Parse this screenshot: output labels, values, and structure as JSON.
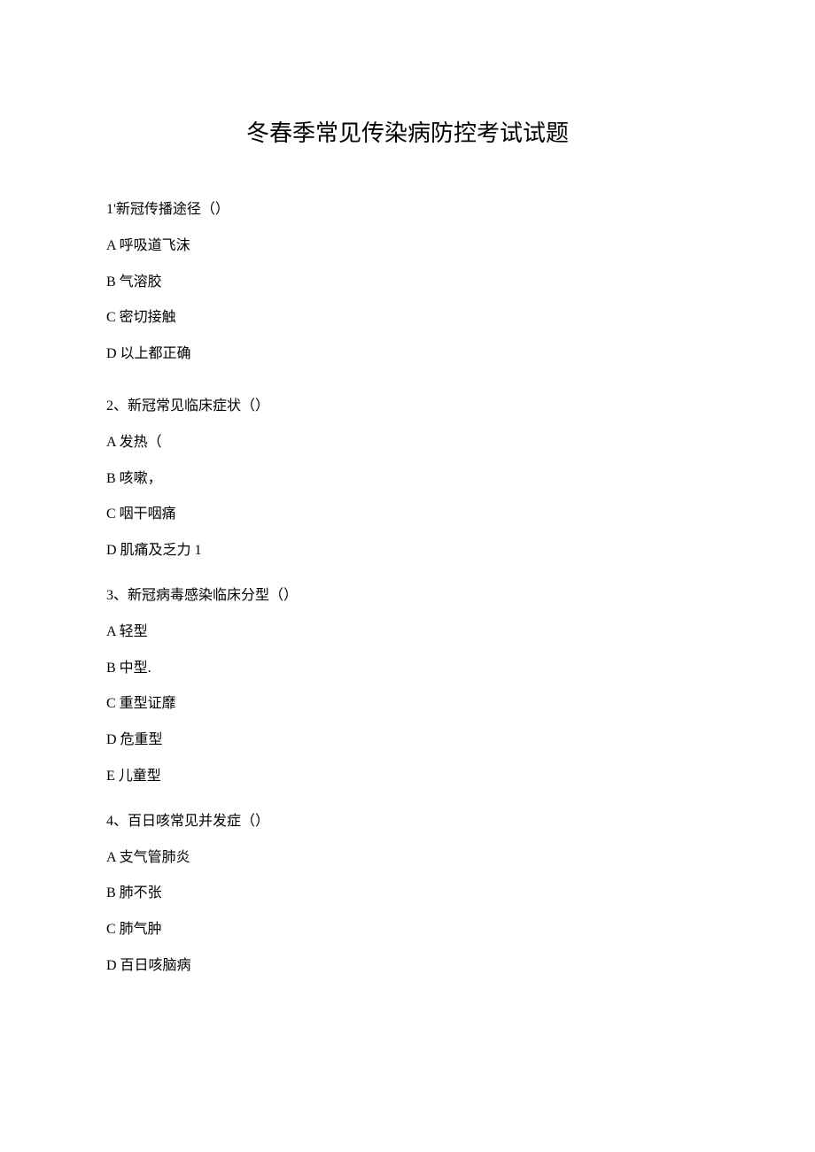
{
  "title": "冬春季常见传染病防控考试试题",
  "questions": [
    {
      "prompt": "1'新冠传播途径（）",
      "options": [
        "A 呼吸道飞沫",
        "B 气溶胶",
        "C 密切接触",
        "D 以上都正确"
      ]
    },
    {
      "prompt": "2、新冠常见临床症状（）",
      "options": [
        "A 发热（",
        "B 咳嗽，",
        "C 咽干咽痛",
        "D 肌痛及乏力 1"
      ]
    },
    {
      "prompt": "3、新冠病毒感染临床分型（）",
      "options": [
        "A 轻型",
        "B 中型.",
        "C 重型证靡",
        "D 危重型",
        "E 儿童型"
      ]
    },
    {
      "prompt": "4、百日咳常见并发症（）",
      "options": [
        "A 支气管肺炎",
        "B 肺不张",
        "C 肺气肿",
        "D 百日咳脑病"
      ]
    }
  ]
}
